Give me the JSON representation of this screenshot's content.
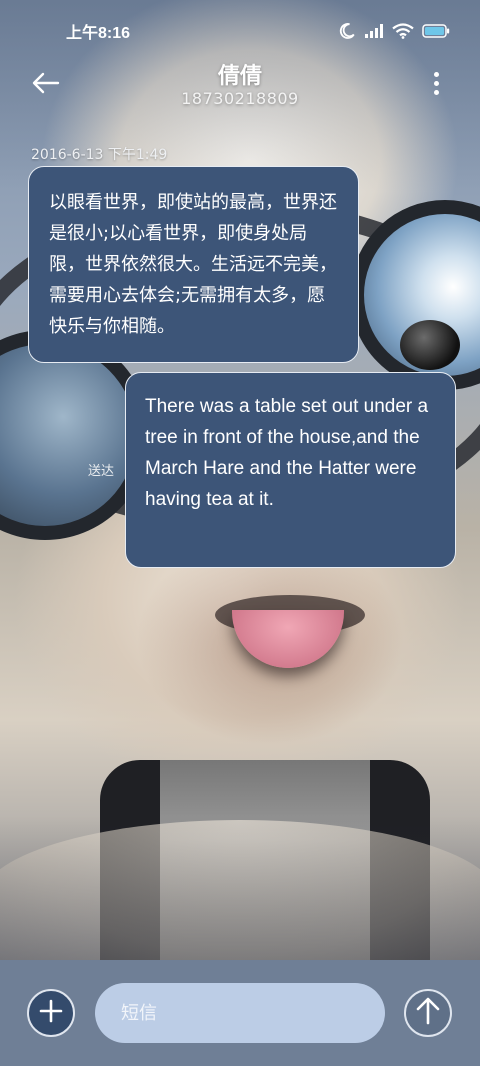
{
  "status_bar": {
    "time": "上午8:16",
    "icons": [
      "moon-icon",
      "signal-icon",
      "wifi-icon",
      "battery-icon"
    ]
  },
  "header": {
    "contact_name": "倩倩",
    "phone_number": "18730218809",
    "back_icon": "arrow-left-icon",
    "menu_icon": "more-vertical-icon"
  },
  "conversation": {
    "timestamp": "2016-6-13 下午1:49",
    "messages": [
      {
        "direction": "incoming",
        "text": "以眼看世界，即使站的最高，世界还是很小;以心看世界，即使身处局限，世界依然很大。生活远不完美，需要用心去体会;无需拥有太多，愿快乐与你相随。"
      },
      {
        "direction": "outgoing",
        "text": "There was a table set out under a tree in front of the house,and the March Hare and the Hatter were having tea at it.",
        "status": "送达"
      }
    ]
  },
  "composer": {
    "placeholder": "短信",
    "value": "",
    "add_icon": "plus-icon",
    "send_icon": "arrow-up-icon"
  },
  "colors": {
    "bubble_fill": "#3d5578",
    "bubble_border": "#e7ecf3",
    "composer_bg": "#6f7f96",
    "input_bg": "#bccde6",
    "battery": "#6fc6e8"
  }
}
